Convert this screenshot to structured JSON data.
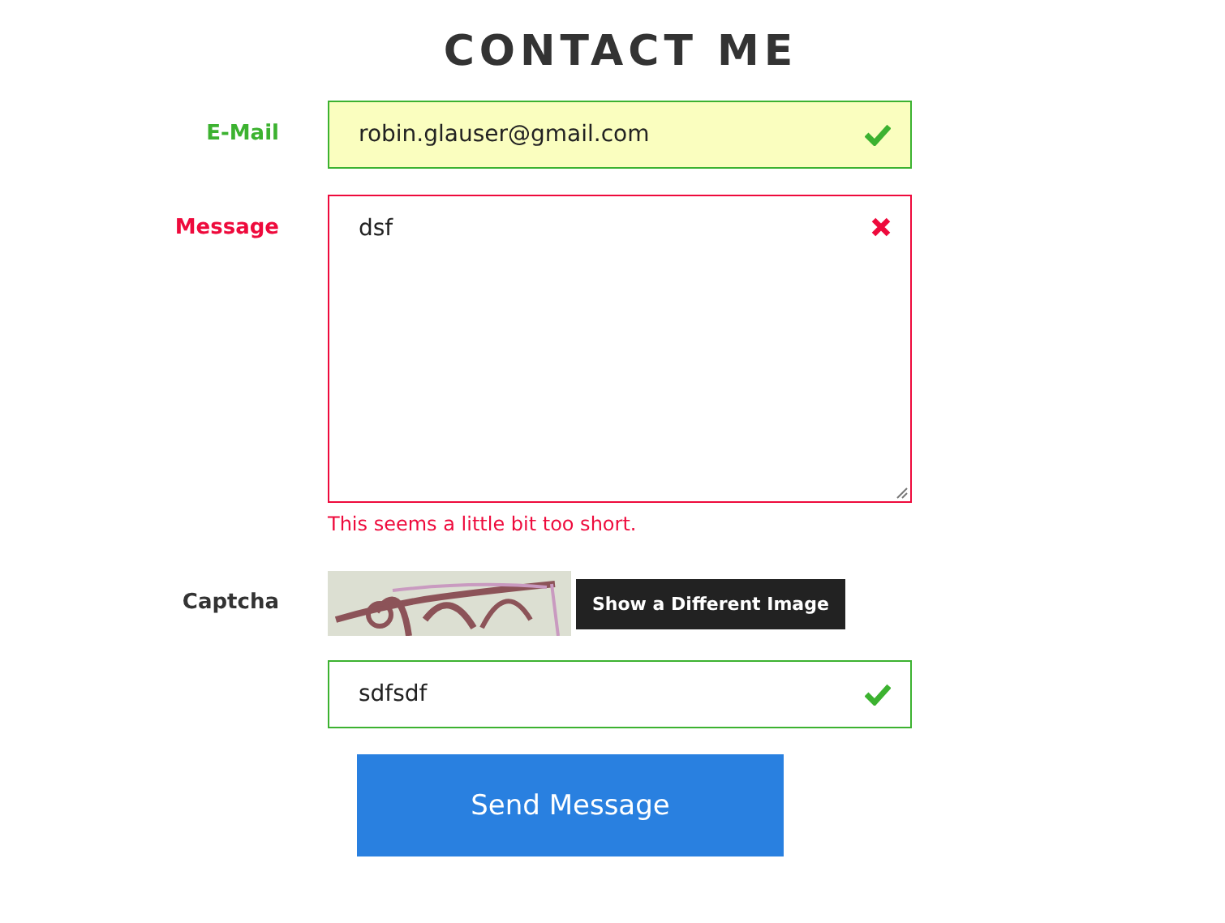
{
  "title": "CONTACT ME",
  "fields": [
    {
      "kind": "input",
      "label": "E-Mail",
      "value": "robin.glauser@gmail.com",
      "valid": true,
      "focused": true
    },
    {
      "kind": "textarea",
      "label": "Message",
      "value": "dsf",
      "valid": false,
      "focused": false,
      "error": "This seems a little bit too short."
    },
    {
      "kind": "captcha",
      "label": "Captcha",
      "refresh_button": "Show a Different Image",
      "value": "sdfsdf",
      "valid": true,
      "focused": false
    }
  ],
  "submit_button": "Send Message"
}
